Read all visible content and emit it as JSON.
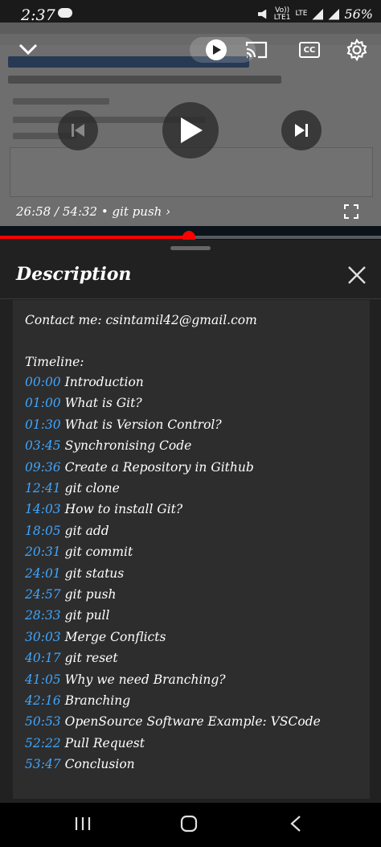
{
  "status_bar": {
    "time": "2:37",
    "volte": "Vo))",
    "lte_top": "LTE",
    "lte_bottom": "LTE1",
    "network": "LTE",
    "battery": "56%"
  },
  "player": {
    "current_time": "26:58",
    "separator": "/",
    "duration": "54:32",
    "chapter": "• git push",
    "chapter_chevron": "›",
    "progress_fraction": 0.495,
    "progress_color": "#ff0000",
    "cc_label": "CC",
    "icons": {
      "collapse": "chevron-down-icon",
      "autoplay": "play-toggle-icon",
      "cast": "cast-icon",
      "captions": "closed-captions-icon",
      "settings": "gear-icon",
      "previous": "skip-previous-icon",
      "play": "play-icon",
      "next": "skip-next-icon",
      "fullscreen": "fullscreen-icon"
    }
  },
  "description": {
    "title": "Description",
    "contact": "Contact me: csintamil42@gmail.com",
    "timeline_label": "Timeline:",
    "timeline": [
      {
        "time": "00:00",
        "label": "Introduction"
      },
      {
        "time": "01:00",
        "label": "What is Git?"
      },
      {
        "time": "01:30",
        "label": "What is Version Control?"
      },
      {
        "time": "03:45",
        "label": "Synchronising Code"
      },
      {
        "time": "09:36",
        "label": "Create a Repository in Github"
      },
      {
        "time": "12:41",
        "label": "git clone"
      },
      {
        "time": "14:03",
        "label": "How to install Git?"
      },
      {
        "time": "18:05",
        "label": "git add"
      },
      {
        "time": "20:31",
        "label": "git commit"
      },
      {
        "time": "24:01",
        "label": "git status"
      },
      {
        "time": "24:57",
        "label": "git push"
      },
      {
        "time": "28:33",
        "label": "git pull"
      },
      {
        "time": "30:03",
        "label": "Merge Conflicts"
      },
      {
        "time": "40:17",
        "label": "git reset"
      },
      {
        "time": "41:05",
        "label": "Why we need Branching?"
      },
      {
        "time": "42:16",
        "label": "Branching"
      },
      {
        "time": "50:53",
        "label": "OpenSource Software Example: VSCode"
      },
      {
        "time": "52:22",
        "label": "Pull Request"
      },
      {
        "time": "53:47",
        "label": "Conclusion"
      }
    ],
    "timestamp_color": "#3ea6ff",
    "close_icon": "close-icon"
  },
  "nav_bar": {
    "recents_icon": "recents-icon",
    "home_icon": "home-icon",
    "back_icon": "back-icon"
  }
}
